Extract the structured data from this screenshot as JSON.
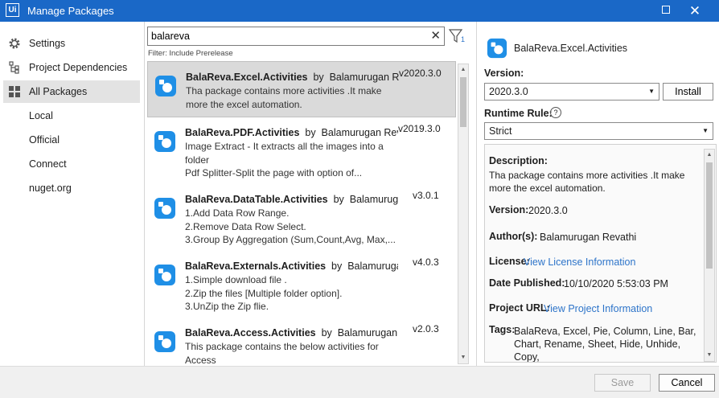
{
  "window": {
    "title": "Manage Packages",
    "logo": "Ui",
    "close_glyph": "✕"
  },
  "sidebar": {
    "items": [
      {
        "label": "Settings",
        "icon": "gear-icon"
      },
      {
        "label": "Project Dependencies",
        "icon": "dependencies-icon"
      },
      {
        "label": "All Packages",
        "icon": "grid-icon"
      },
      {
        "label": "Local"
      },
      {
        "label": "Official"
      },
      {
        "label": "Connect"
      },
      {
        "label": "nuget.org"
      }
    ]
  },
  "search": {
    "value": "balareva",
    "clear_glyph": "✕",
    "filter_count": "1",
    "filter_label": "Filter: Include Prerelease"
  },
  "packages": [
    {
      "name": "BalaReva.Excel.Activities",
      "by": "by",
      "author": "Balamurugan Revathi",
      "version": "v2020.3.0",
      "description": "Tha package contains more activities .It make\nmore the excel automation."
    },
    {
      "name": "BalaReva.PDF.Activities",
      "by": "by",
      "author": "Balamurugan Revathi",
      "version": "v2019.3.0",
      "description": "Image Extract - It extracts all the images into a\nfolder\nPdf Splitter-Split the page with option of..."
    },
    {
      "name": "BalaReva.DataTable.Activities",
      "by": "by",
      "author": "Balamurugan Revathi",
      "version": "v3.0.1",
      "description": "1.Add Data Row Range.\n2.Remove Data Row Select.\n3.Group By Aggregation (Sum,Count,Avg, Max,..."
    },
    {
      "name": "BalaReva.Externals.Activities",
      "by": "by",
      "author": "Balamurugan Revathi",
      "version": "v4.0.3",
      "description": "1.Simple download file .\n2.Zip the files [Multiple folder option].\n3.UnZip the Zip flie."
    },
    {
      "name": "BalaReva.Access.Activities",
      "by": "by",
      "author": "Balamurugan Revathi",
      "version": "v2.0.3",
      "description": "This package contains the below activities for\nAccess"
    }
  ],
  "detail": {
    "package_name": "BalaReva.Excel.Activities",
    "version_label": "Version:",
    "version_value": "2020.3.0",
    "install_label": "Install",
    "runtime_label": "Runtime Rule:",
    "runtime_value": "Strict",
    "help_glyph": "?",
    "description_label": "Description:",
    "description_value": "Tha package contains more activities .It make\nmore the excel automation.",
    "version2_label": "Version:",
    "version2_value": "2020.3.0",
    "authors_label": "Author(s):",
    "authors_value": "Balamurugan Revathi",
    "license_label": "License:",
    "license_link": "View License Information",
    "date_label": "Date Published:",
    "date_value": "10/10/2020 5:53:03 PM",
    "project_label": "Project URL:",
    "project_link": "View Project Information",
    "tags_label": "Tags:",
    "tags_value": "BalaReva, Excel, Pie, Column, Line, Bar,\nChart, Rename, Sheet, Hide, Unhide, Copy,\nData, Cilpboard, export, Access, Add,"
  },
  "footer": {
    "save_label": "Save",
    "cancel_label": "Cancel"
  },
  "colors": {
    "titlebar": "#1a68c7",
    "accent_icon": "#1f8fe6",
    "link": "#2d74c9"
  }
}
